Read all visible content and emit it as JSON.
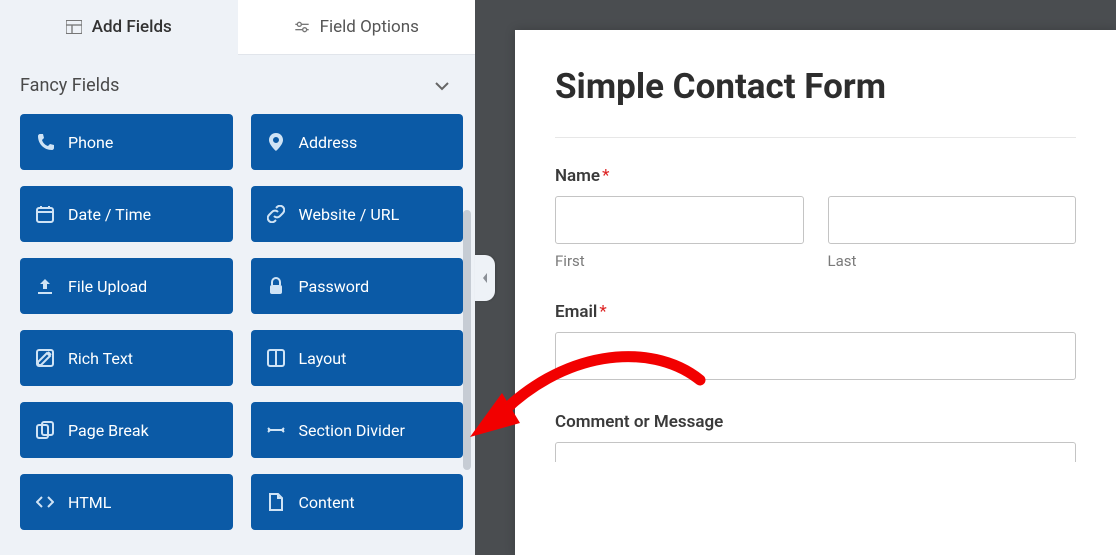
{
  "tabs": {
    "add_fields": "Add Fields",
    "field_options": "Field Options"
  },
  "section": {
    "title": "Fancy Fields"
  },
  "fields": [
    {
      "id": "phone",
      "label": "Phone",
      "icon": "phone"
    },
    {
      "id": "address",
      "label": "Address",
      "icon": "pin"
    },
    {
      "id": "datetime",
      "label": "Date / Time",
      "icon": "calendar"
    },
    {
      "id": "url",
      "label": "Website / URL",
      "icon": "link"
    },
    {
      "id": "upload",
      "label": "File Upload",
      "icon": "upload"
    },
    {
      "id": "password",
      "label": "Password",
      "icon": "lock"
    },
    {
      "id": "richtext",
      "label": "Rich Text",
      "icon": "edit"
    },
    {
      "id": "layout",
      "label": "Layout",
      "icon": "layout"
    },
    {
      "id": "pagebreak",
      "label": "Page Break",
      "icon": "copy"
    },
    {
      "id": "divider",
      "label": "Section Divider",
      "icon": "hr"
    },
    {
      "id": "html",
      "label": "HTML",
      "icon": "code"
    },
    {
      "id": "content",
      "label": "Content",
      "icon": "file"
    }
  ],
  "form": {
    "title": "Simple Contact Form",
    "name": {
      "label": "Name",
      "required": "*",
      "first": "First",
      "last": "Last"
    },
    "email": {
      "label": "Email",
      "required": "*"
    },
    "comment": {
      "label": "Comment or Message"
    }
  }
}
